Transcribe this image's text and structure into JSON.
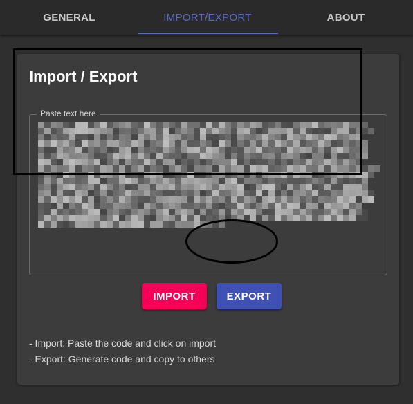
{
  "tabs": [
    {
      "label": "GENERAL",
      "active": false
    },
    {
      "label": "IMPORT/EXPORT",
      "active": true
    },
    {
      "label": "ABOUT",
      "active": false
    }
  ],
  "card": {
    "title": "Import / Export",
    "textarea": {
      "legend": "Paste text here",
      "content": "(pixelated / obscured code text)"
    },
    "buttons": {
      "import_label": "IMPORT",
      "export_label": "EXPORT"
    },
    "help": [
      "- Import: Paste the code and click on import",
      "- Export: Generate code and copy to others"
    ]
  },
  "colors": {
    "accent": "#5c6bc0",
    "import_button": "#f50057",
    "export_button": "#3f51b5",
    "background": "#2f2f2f",
    "card": "#3c3c3c"
  }
}
